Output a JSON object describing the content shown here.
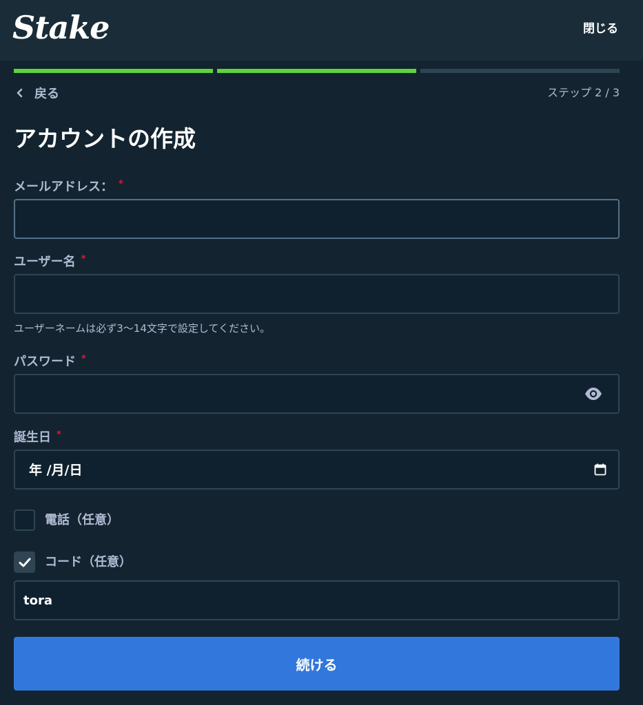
{
  "header": {
    "logo_text": "Stake",
    "close_label": "閉じる"
  },
  "progress": {
    "current_step": 2,
    "total_steps": 3
  },
  "nav": {
    "back_label": "戻る",
    "back_icon": "chevron-left-icon",
    "step_label": "ステップ 2 / 3"
  },
  "form": {
    "title": "アカウントの作成",
    "email": {
      "label": "メールアドレス：",
      "required": "*",
      "value": ""
    },
    "username": {
      "label": "ユーザー名",
      "required": "*",
      "value": "",
      "hint": "ユーザーネームは必ず3〜14文字で設定してください。"
    },
    "password": {
      "label": "パスワード",
      "required": "*",
      "value": "",
      "toggle_icon": "eye-icon"
    },
    "birthday": {
      "label": "誕生日",
      "required": "*",
      "display": "年 /月/日",
      "icon": "calendar-icon"
    },
    "phone_option": {
      "label": "電話（任意）",
      "checked": false
    },
    "code_option": {
      "label": "コード（任意）",
      "checked": true,
      "value": "tora"
    },
    "submit_label": "続ける"
  },
  "colors": {
    "header_bg": "#1a2c38",
    "panel_bg": "#132430",
    "input_bg": "#0f212e",
    "progress_done": "#5dd43d",
    "progress_todo": "#2f4553",
    "required_mark": "#e9113c",
    "button_primary": "#3277db"
  }
}
